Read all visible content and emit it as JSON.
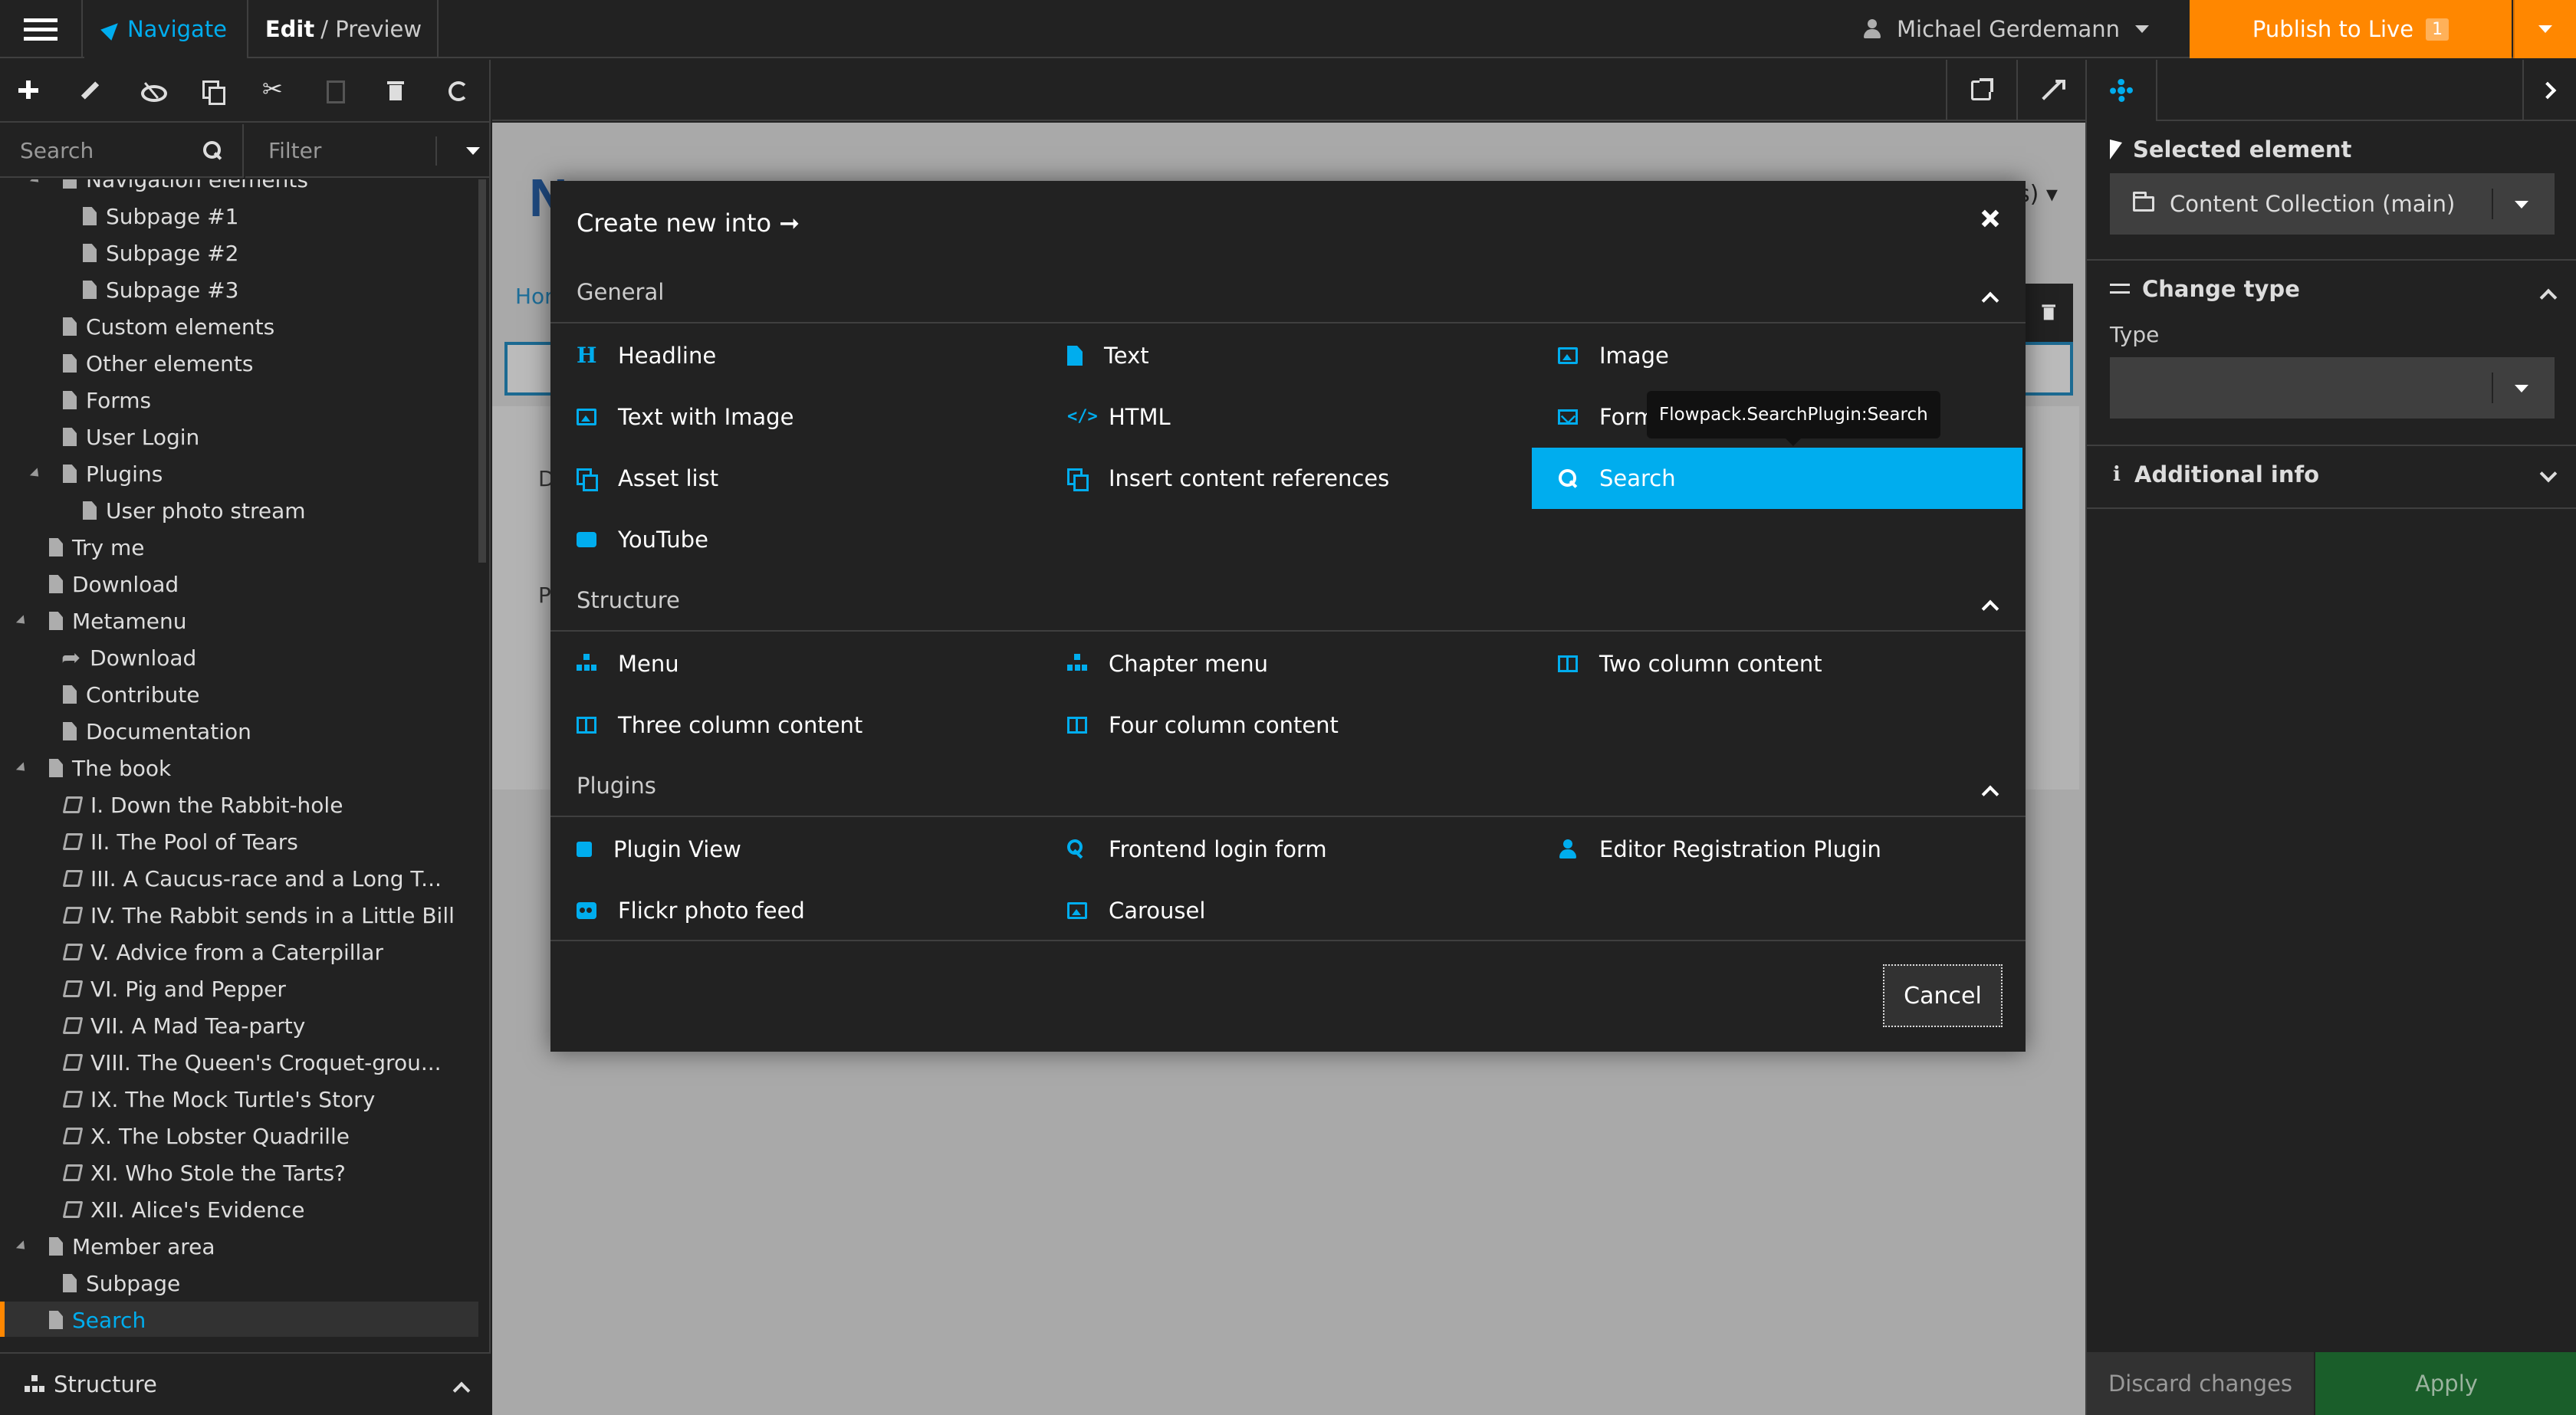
{
  "topbar": {
    "navigate": "Navigate",
    "edit": "Edit",
    "edit_sep": "/",
    "preview": "Preview",
    "user": "Michael Gerdemann",
    "publish": "Publish to Live",
    "publish_count": "1"
  },
  "tree": {
    "search_placeholder": "Search",
    "filter_placeholder": "Filter",
    "nodes": [
      "Navigation elements",
      "Subpage #1",
      "Subpage #2",
      "Subpage #3",
      "Custom elements",
      "Other elements",
      "Forms",
      "User Login",
      "Plugins",
      "User photo stream",
      "Try me",
      "Download",
      "Metamenu",
      "Download",
      "Contribute",
      "Documentation",
      "The book",
      "I. Down the Rabbit-hole",
      "II. The Pool of Tears",
      "III. A Caucus-race and a Long T...",
      "IV. The Rabbit sends in a Little Bill",
      "V. Advice from a Caterpillar",
      "VI. Pig and Pepper",
      "VII. A Mad Tea-party",
      "VIII. The Queen's Croquet-grou...",
      "IX. The Mock Turtle's Story",
      "X. The Lobster Quadrille",
      "XI. Who Stole the Tarts?",
      "XII. Alice's Evidence",
      "Member area",
      "Subpage",
      "Search"
    ],
    "structure_label": "Structure"
  },
  "canvas": {
    "peek_breadcrumb": "Hor",
    "peek_d": "D",
    "peek_p": "P",
    "peek_suffix": "s) ▾"
  },
  "modal": {
    "title": "Create new into ➞",
    "groups": [
      {
        "label": "General",
        "items": [
          "Headline",
          "Text",
          "Image",
          "Text with Image",
          "HTML",
          "Form",
          "Asset list",
          "Insert content references",
          "Search",
          "YouTube"
        ]
      },
      {
        "label": "Structure",
        "items": [
          "Menu",
          "Chapter menu",
          "Two column content",
          "Three column content",
          "Four column content"
        ]
      },
      {
        "label": "Plugins",
        "items": [
          "Plugin View",
          "Frontend login form",
          "Editor Registration Plugin",
          "Flickr photo feed",
          "Carousel"
        ]
      }
    ],
    "headline_icon_glyph": "H",
    "html_icon_glyph": "</>",
    "tooltip": "Flowpack.SearchPlugin:Search",
    "cancel": "Cancel"
  },
  "inspector": {
    "selected_element_label": "Selected element",
    "selected_element_value": "Content Collection (main)",
    "change_type_label": "Change type",
    "type_label": "Type",
    "type_value": "",
    "additional_info_label": "Additional info",
    "discard": "Discard changes",
    "apply": "Apply"
  },
  "colors": {
    "accent": "#00adee",
    "publish": "#ff8700",
    "apply": "#1a5e2a",
    "background": "#222222"
  }
}
